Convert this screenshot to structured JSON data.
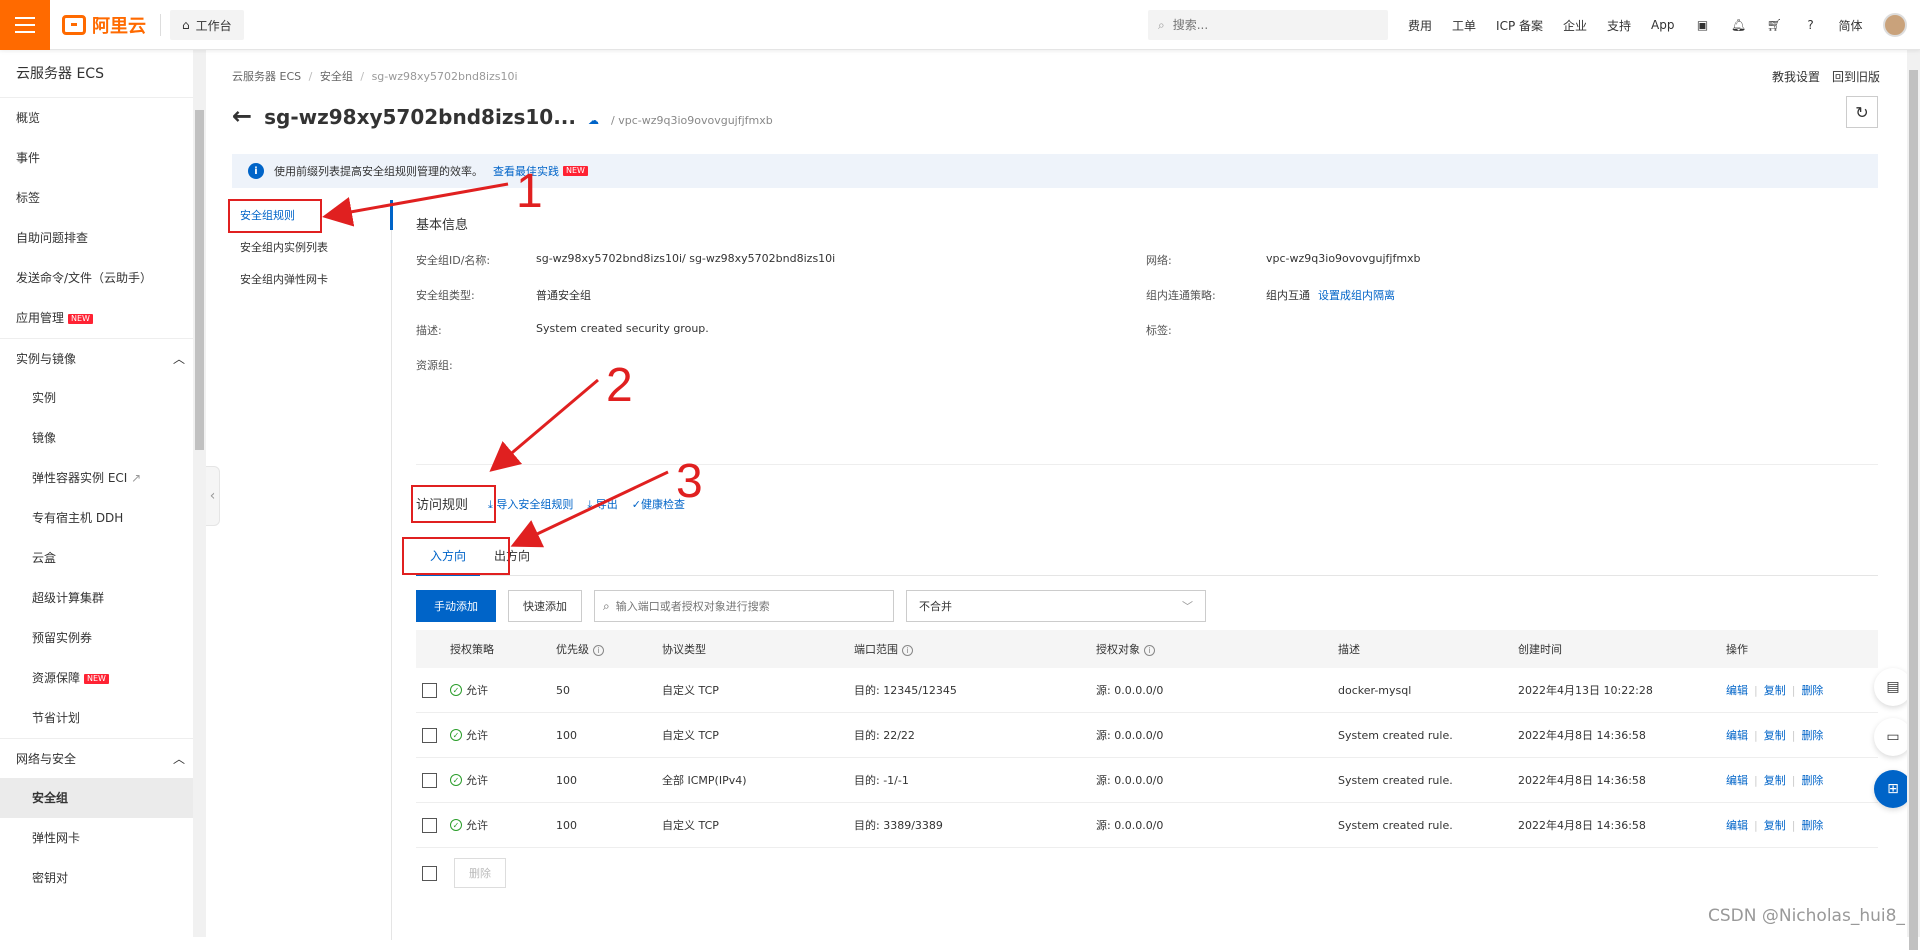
{
  "topbar": {
    "logo_text": "阿里云",
    "workbench_label": "工作台",
    "search_placeholder": "搜索...",
    "nav": [
      "费用",
      "工单",
      "ICP 备案",
      "企业",
      "支持",
      "App"
    ],
    "lang": "简体"
  },
  "sidebar": {
    "title": "云服务器 ECS",
    "items_top": [
      {
        "label": "概览"
      },
      {
        "label": "事件"
      },
      {
        "label": "标签"
      },
      {
        "label": "自助问题排查"
      },
      {
        "label": "发送命令/文件（云助手）"
      },
      {
        "label": "应用管理",
        "badge": "NEW"
      }
    ],
    "group1": "实例与镜像",
    "group1_items": [
      {
        "label": "实例"
      },
      {
        "label": "镜像"
      },
      {
        "label": "弹性容器实例 ECI",
        "ext": "↗"
      },
      {
        "label": "专有宿主机 DDH"
      },
      {
        "label": "云盒"
      },
      {
        "label": "超级计算集群"
      },
      {
        "label": "预留实例券"
      },
      {
        "label": "资源保障",
        "badge": "NEW"
      },
      {
        "label": "节省计划"
      }
    ],
    "group2": "网络与安全",
    "group2_items": [
      {
        "label": "安全组"
      },
      {
        "label": "弹性网卡"
      },
      {
        "label": "密钥对"
      }
    ]
  },
  "breadcrumb": {
    "items": [
      "云服务器 ECS",
      "安全组",
      "sg-wz98xy5702bnd8izs10i"
    ],
    "separator": "/"
  },
  "header": {
    "title": "sg-wz98xy5702bnd8izs10...",
    "vpc": "/ vpc-wz9q3io9ovovgujfjfmxb",
    "link_settings": "教我设置",
    "link_old": "回到旧版"
  },
  "notice": {
    "text": "使用前缀列表提高安全组规则管理的效率。",
    "link": "查看最佳实践",
    "badge": "NEW"
  },
  "leftnav": {
    "items": [
      "安全组规则",
      "安全组内实例列表",
      "安全组内弹性网卡"
    ]
  },
  "basic_info": {
    "title": "基本信息",
    "rows": [
      {
        "k": "安全组ID/名称:",
        "v": "sg-wz98xy5702bnd8izs10i/ sg-wz98xy5702bnd8izs10i",
        "k2": "网络:",
        "v2": "vpc-wz9q3io9ovovgujfjfmxb"
      },
      {
        "k": "安全组类型:",
        "v": "普通安全组",
        "k2": "组内连通策略:",
        "v2": "组内互通",
        "v2_link": "设置成组内隔离"
      },
      {
        "k": "描述:",
        "v": "System created security group.",
        "k2": "标签:",
        "v2": ""
      },
      {
        "k": "资源组:",
        "v": "",
        "k2": "",
        "v2": ""
      }
    ]
  },
  "rules": {
    "title": "访问规则",
    "import": "导入安全组规则",
    "export": "导出",
    "health": "健康检查",
    "tabs": [
      "入方向",
      "出方向"
    ],
    "btn_manual": "手动添加",
    "btn_quick": "快速添加",
    "search_placeholder": "输入端口或者授权对象进行搜索",
    "select_value": "不合并",
    "columns": [
      "授权策略",
      "优先级",
      "协议类型",
      "端口范围",
      "授权对象",
      "描述",
      "创建时间",
      "操作"
    ],
    "rows": [
      {
        "policy": "允许",
        "priority": "50",
        "protocol": "自定义 TCP",
        "port": "目的: 12345/12345",
        "auth": "源: 0.0.0.0/0",
        "desc": "docker-mysql",
        "time": "2022年4月13日 10:22:28"
      },
      {
        "policy": "允许",
        "priority": "100",
        "protocol": "自定义 TCP",
        "port": "目的: 22/22",
        "auth": "源: 0.0.0.0/0",
        "desc": "System created rule.",
        "time": "2022年4月8日 14:36:58"
      },
      {
        "policy": "允许",
        "priority": "100",
        "protocol": "全部 ICMP(IPv4)",
        "port": "目的: -1/-1",
        "auth": "源: 0.0.0.0/0",
        "desc": "System created rule.",
        "time": "2022年4月8日 14:36:58"
      },
      {
        "policy": "允许",
        "priority": "100",
        "protocol": "自定义 TCP",
        "port": "目的: 3389/3389",
        "auth": "源: 0.0.0.0/0",
        "desc": "System created rule.",
        "time": "2022年4月8日 14:36:58"
      }
    ],
    "ops": [
      "编辑",
      "复制",
      "删除"
    ],
    "bulk_delete": "删除"
  },
  "annotations": [
    "1",
    "2",
    "3"
  ],
  "watermark": "CSDN @Nicholas_hui8_",
  "colors": {
    "brand": "#ff6a00",
    "primary": "#0064c8",
    "annotation": "#e02020"
  }
}
